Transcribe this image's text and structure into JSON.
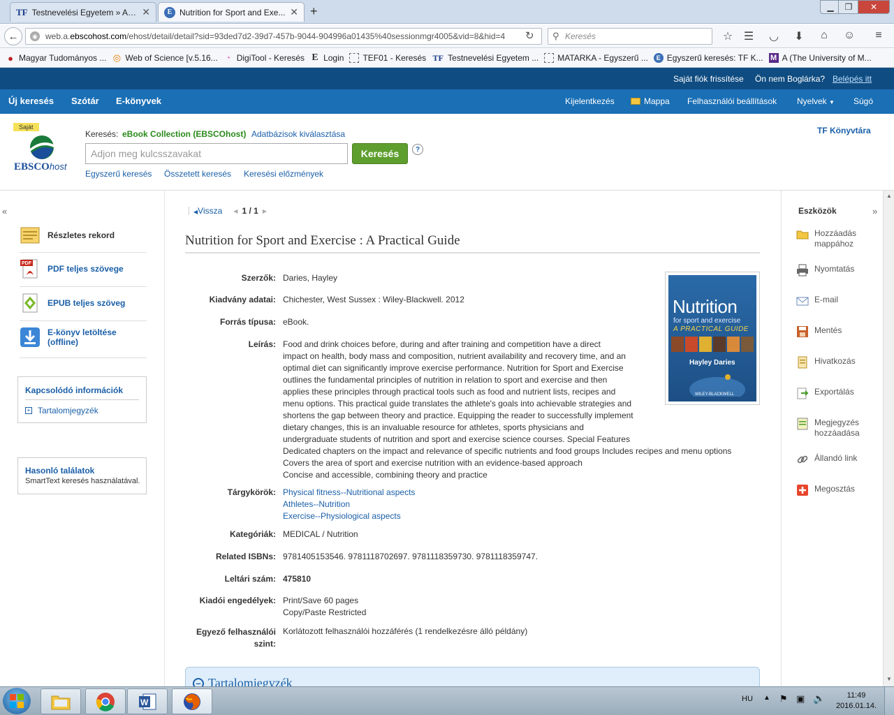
{
  "browser": {
    "tabs": [
      {
        "favicon": "TF",
        "title": "Testnevelési Egyetem » Ad..."
      },
      {
        "favicon": "E",
        "title": "Nutrition for Sport and Exe..."
      }
    ],
    "url_prefix": "web.a.",
    "url_domain": "ebscohost.com",
    "url_rest": "/ehost/detail/detail?sid=93ded7d2-39d7-457b-9044-904996a01435%40sessionmgr4005&vid=8&hid=4",
    "search_placeholder": "Keresés",
    "bookmarks": [
      {
        "icon": "mtmt-icon",
        "label": "Magyar Tudományos ..."
      },
      {
        "icon": "wos-icon",
        "label": "Web of Science [v.5.16..."
      },
      {
        "icon": "digitool-icon",
        "label": "DigiTool - Keresés"
      },
      {
        "icon": "e-icon",
        "label": "Login"
      },
      {
        "icon": "page-icon",
        "label": "TEF01 - Keresés"
      },
      {
        "icon": "tf-icon",
        "label": "Testnevelési Egyetem ..."
      },
      {
        "icon": "page-icon",
        "label": "MATARKA - Egyszerű ..."
      },
      {
        "icon": "ebsco-icon",
        "label": "Egyszerű keresés: TF K..."
      },
      {
        "icon": "m-icon",
        "label": "A (The University of M..."
      }
    ]
  },
  "topstrip": {
    "refresh": "Saját fiók frissítése",
    "not_user": "Ön nem Boglárka?",
    "login": "Belépés itt"
  },
  "menu": {
    "left": [
      "Új keresés",
      "Szótár",
      "E-könyvek"
    ],
    "logout": "Kijelentkezés",
    "folder": "Mappa",
    "settings": "Felhasználói beállítások",
    "languages": "Nyelvek",
    "help": "Súgó"
  },
  "header": {
    "badge": "Saját",
    "logo_bold": "EBSCO",
    "logo_italic": "host",
    "searching_label": "Keresés:",
    "database": "eBook Collection (EBSCOhost)",
    "choose_db": "Adatbázisok kiválasztása",
    "input_placeholder": "Adjon meg kulcsszavakat",
    "search_button": "Keresés",
    "help": "?",
    "links": [
      "Egyszerű keresés",
      "Összetett keresés",
      "Keresési előzmények"
    ],
    "library": "TF Könyvtára"
  },
  "left": {
    "items": [
      {
        "label": "Részletes rekord"
      },
      {
        "label": "PDF teljes szövege"
      },
      {
        "label": "EPUB teljes szöveg"
      },
      {
        "label": "E-könyv letöltése (offline)"
      }
    ],
    "pdf_badge": "PDF",
    "related_title": "Kapcsolódó információk",
    "toc_link": "Tartalomjegyzék",
    "similar_title": "Hasonló találatok",
    "similar_sub": "SmartText keresés használatával."
  },
  "record": {
    "back": "Vissza",
    "pager": "1 / 1",
    "title": "Nutrition for Sport and Exercise : A Practical Guide",
    "fields": {
      "authors_label": "Szerzők:",
      "authors": "Daries, Hayley",
      "pub_label": "Kiadvány adatai:",
      "pub": "Chichester, West Sussex : Wiley-Blackwell. 2012",
      "source_label": "Forrás típusa:",
      "source": "eBook.",
      "desc_label": "Leírás:",
      "desc_lines": [
        "Food and drink choices before, during and after training and competition have a direct",
        "impact on health, body mass and composition, nutrient availability and recovery time, and an",
        "optimal diet can significantly improve exercise performance. Nutrition for Sport and Exercise",
        "outlines the fundamental principles of nutrition in relation to sport and exercise and then",
        "applies these principles through practical tools such as food and nutrient lists, recipes and",
        "menu options. This practical guide translates the athlete's goals into achievable strategies and",
        "shortens the gap between theory and practice. Equipping the reader to successfully implement",
        "dietary changes, this is an invaluable resource for athletes, sports physicians and",
        "undergraduate students of nutrition and sport and exercise science courses. Special Features",
        "Dedicated chapters on the impact and relevance of specific nutrients and food groups Includes recipes and menu options",
        "Covers the area of sport and exercise nutrition with an evidence-based approach",
        "Concise and accessible, combining theory and practice"
      ],
      "subjects_label": "Tárgykörök:",
      "subjects": [
        "Physical fitness--Nutritional aspects",
        "Athletes--Nutrition",
        "Exercise--Physiological aspects"
      ],
      "categories_label": "Kategóriák:",
      "categories": "MEDICAL / Nutrition",
      "isbn_label": "Related ISBNs:",
      "isbn": "9781405153546. 9781118702697. 9781118359730. 9781118359747.",
      "accession_label": "Leltári szám:",
      "accession": "475810",
      "perm_label": "Kiadói engedélyek:",
      "perm_lines": [
        "Print/Save 60 pages",
        "Copy/Paste Restricted"
      ],
      "users_label_1": "Egyező felhasználói",
      "users_label_2": "szint:",
      "users": "Korlátozott felhasználói hozzáférés (1 rendelkezésre álló példány)"
    },
    "cover": {
      "title": "Nutrition",
      "sub1": "for sport and exercise",
      "sub2": "A PRACTICAL GUIDE",
      "author": "Hayley Daries",
      "publisher": "WILEY-BLACKWELL"
    },
    "toc_panel": "Tartalomjegyzék"
  },
  "tools": {
    "title": "Eszközök",
    "items": [
      {
        "icon": "folder-icon",
        "label1": "Hozzáadás",
        "label2": "mappához"
      },
      {
        "icon": "printer-icon",
        "label1": "Nyomtatás",
        "label2": ""
      },
      {
        "icon": "email-icon",
        "label1": "E-mail",
        "label2": ""
      },
      {
        "icon": "save-icon",
        "label1": "Mentés",
        "label2": ""
      },
      {
        "icon": "cite-icon",
        "label1": "Hivatkozás",
        "label2": ""
      },
      {
        "icon": "export-icon",
        "label1": "Exportálás",
        "label2": ""
      },
      {
        "icon": "note-icon",
        "label1": "Megjegyzés",
        "label2": "hozzáadása"
      },
      {
        "icon": "permalink-icon",
        "label1": "Állandó link",
        "label2": ""
      },
      {
        "icon": "share-icon",
        "label1": "Megosztás",
        "label2": ""
      }
    ]
  },
  "taskbar": {
    "lang": "HU",
    "time": "11:49",
    "date": "2016.01.14."
  }
}
